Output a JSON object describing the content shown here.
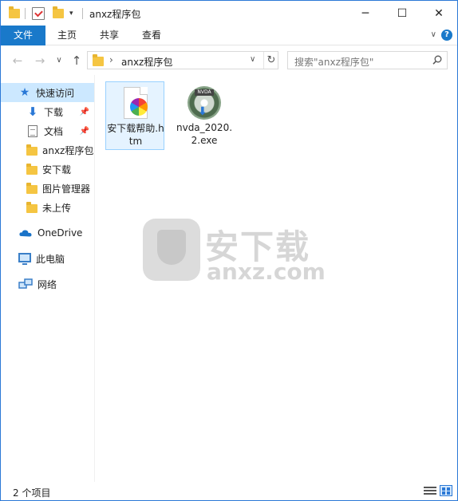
{
  "window": {
    "title": "anxz程序包"
  },
  "window_controls": {
    "minimize": "─",
    "maximize": "☐",
    "close": "✕"
  },
  "ribbon": {
    "tabs": [
      "文件",
      "主页",
      "共享",
      "查看"
    ],
    "expand_glyph": "∨",
    "help_glyph": "?"
  },
  "nav": {
    "back_glyph": "←",
    "forward_glyph": "→",
    "recent_glyph": "∨",
    "up_glyph": "↑"
  },
  "address": {
    "chevron": "›",
    "path": "anxz程序包",
    "dropdown_glyph": "∨",
    "refresh_glyph": "↻"
  },
  "search": {
    "placeholder": "搜索\"anxz程序包\""
  },
  "sidebar": {
    "items": [
      {
        "label": "快速访问",
        "icon": "star-icon",
        "pinned": false
      },
      {
        "label": "下载",
        "icon": "download-icon",
        "pinned": true
      },
      {
        "label": "文档",
        "icon": "document-icon",
        "pinned": true
      },
      {
        "label": "anxz程序包",
        "icon": "folder-icon",
        "pinned": false
      },
      {
        "label": "安下载",
        "icon": "folder-icon",
        "pinned": false
      },
      {
        "label": "图片管理器",
        "icon": "folder-icon",
        "pinned": false
      },
      {
        "label": "未上传",
        "icon": "folder-icon",
        "pinned": false
      },
      {
        "label": "OneDrive",
        "icon": "cloud-icon",
        "pinned": false
      },
      {
        "label": "此电脑",
        "icon": "computer-icon",
        "pinned": false
      },
      {
        "label": "网络",
        "icon": "network-icon",
        "pinned": false
      }
    ],
    "pin_glyph": "📌"
  },
  "files": [
    {
      "name": "安下载帮助.htm",
      "icon": "htm-file-icon",
      "selected": true
    },
    {
      "name": "nvda_2020.2.exe",
      "icon": "exe-file-icon",
      "selected": false
    }
  ],
  "exe_icon_tag": "NVDA",
  "watermark": {
    "big": "安下载",
    "small": "anxz.com"
  },
  "statusbar": {
    "item_count": "2 个项目"
  },
  "colors": {
    "accent": "#1979ca",
    "selection": "#cce8ff",
    "folder": "#f5c542"
  }
}
